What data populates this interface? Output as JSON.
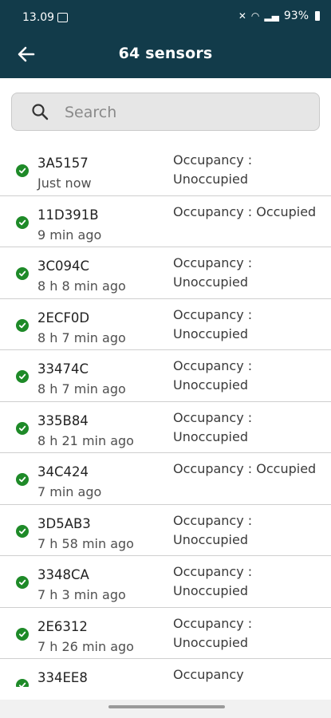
{
  "status_bar": {
    "time": "13.09",
    "battery": "93%"
  },
  "header": {
    "title": "64 sensors"
  },
  "search": {
    "placeholder": "Search"
  },
  "sensors": [
    {
      "id": "3A5157",
      "time": "Just now",
      "status": "Occupancy : Unoccupied"
    },
    {
      "id": "11D391B",
      "time": "9 min ago",
      "status": "Occupancy : Occupied"
    },
    {
      "id": "3C094C",
      "time": "8 h 8 min ago",
      "status": "Occupancy : Unoccupied"
    },
    {
      "id": "2ECF0D",
      "time": "8 h 7 min ago",
      "status": "Occupancy : Unoccupied"
    },
    {
      "id": "33474C",
      "time": "8 h 7 min ago",
      "status": "Occupancy : Unoccupied"
    },
    {
      "id": "335B84",
      "time": "8 h 21 min ago",
      "status": "Occupancy : Unoccupied"
    },
    {
      "id": "34C424",
      "time": "7 min ago",
      "status": "Occupancy : Occupied"
    },
    {
      "id": "3D5AB3",
      "time": "7 h 58 min ago",
      "status": "Occupancy : Unoccupied"
    },
    {
      "id": "3348CA",
      "time": "7 h 3 min ago",
      "status": "Occupancy : Unoccupied"
    },
    {
      "id": "2E6312",
      "time": "7 h 26 min ago",
      "status": "Occupancy : Unoccupied"
    },
    {
      "id": "334EE8",
      "time": "",
      "status": "Occupancy"
    }
  ]
}
